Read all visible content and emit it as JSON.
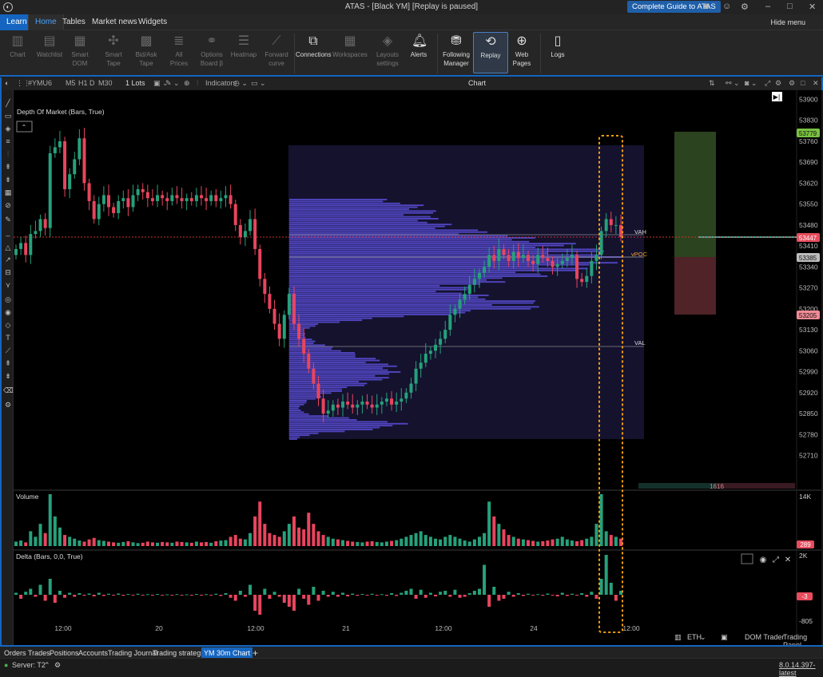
{
  "window": {
    "title": "ATAS - [Black YM] [Replay is paused]",
    "guide_button": "Complete Guide to ATAS"
  },
  "menu": {
    "tabs": [
      "Learn",
      "Home",
      "Tables",
      "Market news",
      "Widgets"
    ],
    "hide_menu": "Hide menu"
  },
  "ribbon": {
    "chart": "Chart",
    "watchlist": "Watchlist",
    "smart_dom_1": "Smart",
    "smart_dom_2": "DOM",
    "smart_tape_1": "Smart",
    "smart_tape_2": "Tape",
    "bidask_1": "Bid/Ask",
    "bidask_2": "Tape",
    "allprices_1": "All",
    "allprices_2": "Prices",
    "options_1": "Options",
    "options_2": "Board β",
    "heatmap": "Heatmap",
    "forward_1": "Forward",
    "forward_2": "curve",
    "connections": "Connections",
    "workspaces": "Workspaces",
    "layouts_1": "Layouts",
    "layouts_2": "settings",
    "alerts": "Alerts",
    "following_1": "Following",
    "following_2": "Manager",
    "replay": "Replay",
    "web_1": "Web",
    "web_2": "Pages",
    "logs": "Logs"
  },
  "chart_toolbar": {
    "symbol": "#YMU6",
    "tf_m5": "M5",
    "tf_h1": "H1",
    "tf_d": "D",
    "tf_m30": "M30",
    "lots": "1 Lots",
    "indicators": "Indicators",
    "chart_title": "Chart"
  },
  "chart": {
    "indicator_label": "Depth Of Market (Bars, True)",
    "volume_label": "Volume",
    "delta_label": "Delta (Bars, 0,0, True)",
    "price_ticks": [
      "53900",
      "53830",
      "53760",
      "53690",
      "53620",
      "53550",
      "53480",
      "53410",
      "53340",
      "53270",
      "53200",
      "53130",
      "53060",
      "52990",
      "52920",
      "52850",
      "52780",
      "52710"
    ],
    "price_badges": {
      "top_green": "53779",
      "current": "53447",
      "gray": "53385",
      "red": "53205"
    },
    "profile_labels": {
      "vah": "VAH",
      "vpoc": "vPOC",
      "val": "VAL"
    },
    "volume_axis": {
      "top": "14K",
      "badge": "289"
    },
    "delta_axis": {
      "top": "2K",
      "badge": "-3",
      "bottom": "-805"
    },
    "time_labels": [
      "12:00",
      "20",
      "12:00",
      "21",
      "12:00",
      "24",
      "12:00"
    ],
    "ruler_value": "1616",
    "colors": {
      "bull": "#26a17b",
      "bear": "#e8455e",
      "profile": "#5a4fd8",
      "profile_bg": "#15122e",
      "highlight": "#f39c12"
    }
  },
  "chart_bottom": {
    "eth": "ETH",
    "dom_trader": "DOM Trader",
    "trading_panel": "Trading Panel"
  },
  "bottom_tabs": [
    "Orders",
    "Trades",
    "Positions",
    "Accounts",
    "Trading Journal",
    "Trading strategies",
    "YM 30m Chart"
  ],
  "status": {
    "server": "Server: T2",
    "version": "8.0.14.397-latest"
  },
  "chart_data": {
    "type": "candlestick",
    "y_axis_ticks": [
      53900,
      53830,
      53760,
      53690,
      53620,
      53550,
      53480,
      53410,
      53340,
      53270,
      53200,
      53130,
      53060,
      52990,
      52920,
      52850,
      52780,
      52710
    ],
    "ylim": [
      52690,
      53920
    ],
    "x_labels": [
      "12:00",
      "20",
      "12:00",
      "21",
      "12:00",
      "24",
      "12:00"
    ],
    "current_price": 53447,
    "vpoc": 53385,
    "vah": 53447,
    "val": 53130,
    "closes": [
      53400,
      53420,
      53380,
      53450,
      53460,
      53500,
      53470,
      53720,
      53740,
      53760,
      53600,
      53650,
      53700,
      53770,
      53620,
      53560,
      53500,
      53550,
      53580,
      53540,
      53520,
      53560,
      53570,
      53540,
      53580,
      53600,
      53590,
      53570,
      53560,
      53580,
      53570,
      53560,
      53580,
      53570,
      53560,
      53570,
      53560,
      53580,
      53570,
      53560,
      53580,
      53560,
      53570,
      53580,
      53550,
      53480,
      53440,
      53460,
      53500,
      53400,
      53300,
      53250,
      53200,
      53150,
      53100,
      53180,
      53250,
      53150,
      53100,
      53050,
      53000,
      52950,
      52900,
      52850,
      52860,
      52880,
      52870,
      52890,
      52880,
      52870,
      52880,
      52890,
      52880,
      52870,
      52880,
      52890,
      52900,
      52880,
      52890,
      52900,
      52920,
      52950,
      53000,
      53020,
      53050,
      53060,
      53080,
      53100,
      53130,
      53180,
      53200,
      53230,
      53250,
      53280,
      53300,
      53320,
      53340,
      53380,
      53360,
      53400,
      53380,
      53360,
      53390,
      53370,
      53380,
      53360,
      53350,
      53380,
      53370,
      53360,
      53340,
      53350,
      53360,
      53370,
      53380,
      53300,
      53290,
      53310,
      53360,
      53380,
      53460,
      53500,
      53480,
      53480,
      53440
    ],
    "volume_values": [
      1200,
      1500,
      1000,
      4000,
      2500,
      6000,
      3500,
      14000,
      8000,
      5000,
      3000,
      2500,
      2000,
      1500,
      1200,
      1800,
      2200,
      1600,
      1400,
      1200,
      1000,
      900,
      1100,
      1300,
      1000,
      800,
      900,
      1200,
      1000,
      900,
      1100,
      1000,
      900,
      1200,
      1100,
      1000,
      900,
      1200,
      1000,
      1100,
      900,
      1300,
      1500,
      1600,
      2500,
      3000,
      2000,
      1800,
      3500,
      8000,
      12000,
      6000,
      3500,
      3000,
      2500,
      4000,
      6000,
      8000,
      5000,
      4500,
      9000,
      6000,
      4000,
      3000,
      2500,
      2000,
      1800,
      1600,
      1400,
      1200,
      1100,
      1000,
      1200,
      1300,
      1100,
      1000,
      1200,
      1400,
      1600,
      2000,
      2500,
      3000,
      3500,
      4000,
      3000,
      2500,
      2000,
      1800,
      2500,
      3000,
      2500,
      2000,
      1500,
      1200,
      1800,
      2500,
      3500,
      12000,
      8000,
      6000,
      4500,
      3000,
      2500,
      2000,
      1800,
      1600,
      1400,
      1200,
      1300,
      1500,
      1800,
      2000,
      2500,
      1800,
      1500,
      1300,
      1600,
      2000,
      2500,
      6000,
      14000,
      4000,
      3000,
      2500,
      2000
    ],
    "delta_values": [
      100,
      -200,
      150,
      300,
      -100,
      500,
      -300,
      800,
      -400,
      200,
      -150,
      100,
      -100,
      80,
      -50,
      60,
      -80,
      100,
      -60,
      50,
      -40,
      60,
      -50,
      40,
      -30,
      50,
      -40,
      30,
      -20,
      40,
      -30,
      20,
      -20,
      30,
      -20,
      20,
      -30,
      40,
      -20,
      30,
      -40,
      50,
      -60,
      80,
      -150,
      -300,
      200,
      -100,
      500,
      -800,
      -1000,
      300,
      -200,
      150,
      -100,
      -400,
      -600,
      -800,
      300,
      -200,
      -500,
      400,
      -300,
      200,
      -100,
      150,
      -100,
      100,
      -80,
      60,
      -50,
      40,
      -30,
      50,
      -40,
      30,
      -50,
      80,
      -60,
      100,
      200,
      300,
      -200,
      250,
      -150,
      100,
      -80,
      150,
      200,
      -100,
      250,
      -150,
      -100,
      80,
      200,
      300,
      1500,
      -600,
      400,
      -300,
      -200,
      150,
      -100,
      80,
      -60,
      50,
      -40,
      30,
      -50,
      60,
      -40,
      -80,
      100,
      -60,
      50,
      -40,
      80,
      -100,
      150,
      -200,
      800,
      2000,
      600,
      -300,
      200
    ]
  }
}
